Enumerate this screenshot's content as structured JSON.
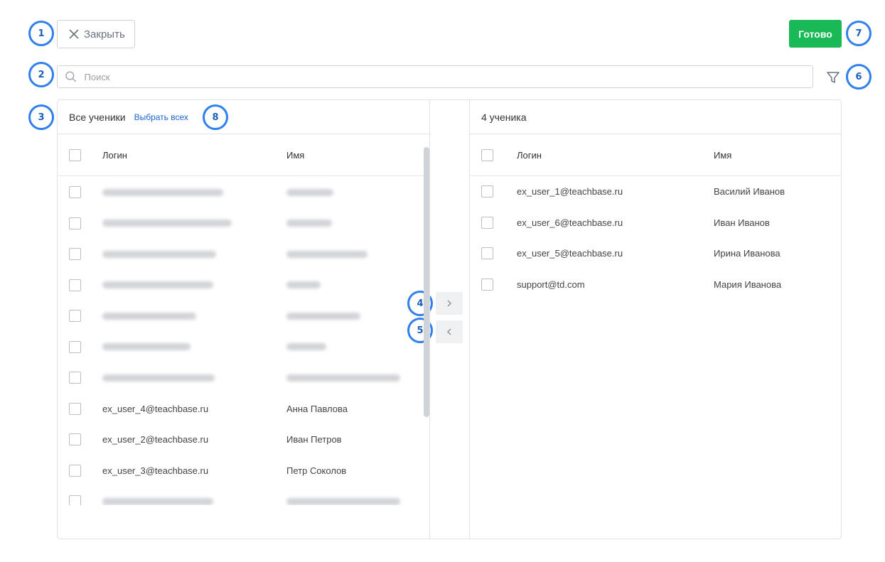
{
  "badges": [
    "1",
    "2",
    "3",
    "4",
    "5",
    "6",
    "7",
    "8"
  ],
  "toolbar": {
    "close_label": "Закрыть",
    "done_label": "Готово"
  },
  "search": {
    "placeholder": "Поиск"
  },
  "left": {
    "title": "Все ученики",
    "select_all": "Выбрать всех",
    "col_login": "Логин",
    "col_name": "Имя",
    "rows": [
      {
        "login": "ex_user_4@teachbase.ru",
        "name": "Анна Павлова"
      },
      {
        "login": "ex_user_2@teachbase.ru",
        "name": "Иван Петров"
      },
      {
        "login": "ex_user_3@teachbase.ru",
        "name": "Петр Соколов"
      }
    ]
  },
  "right": {
    "title": "4 ученика",
    "col_login": "Логин",
    "col_name": "Имя",
    "rows": [
      {
        "login": "ex_user_1@teachbase.ru",
        "name": "Василий Иванов"
      },
      {
        "login": "ex_user_6@teachbase.ru",
        "name": "Иван Иванов"
      },
      {
        "login": "ex_user_5@teachbase.ru",
        "name": "Ирина Иванова"
      },
      {
        "login": "support@td.com",
        "name": "Мария Иванова"
      }
    ]
  },
  "icons": {
    "close": "close-icon",
    "search": "search-icon",
    "filter": "filter-icon",
    "move_right": "chevron-right-icon",
    "move_left": "chevron-left-icon"
  },
  "colors": {
    "accent": "#19b955",
    "link": "#1a66d2",
    "badge": "#2f80ed"
  }
}
